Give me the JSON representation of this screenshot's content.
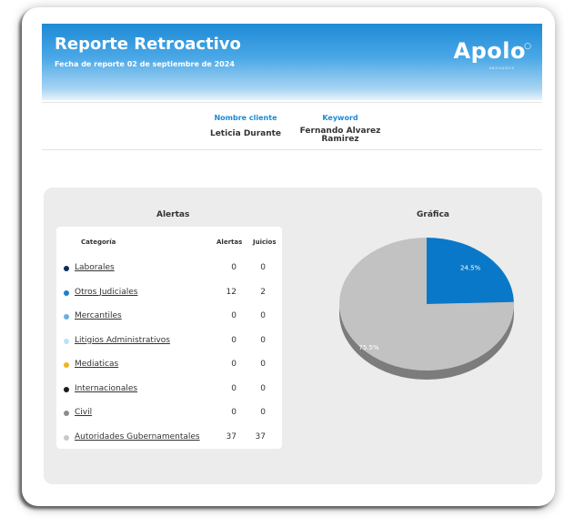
{
  "header": {
    "title": "Reporte Retroactivo",
    "date": "Fecha de reporte 02 de septiembre de 2024",
    "logo": "Apolo",
    "logo_sub": "ABOGADOS"
  },
  "client": {
    "name_label": "Nombre cliente",
    "name_value": "Leticia Durante",
    "keyword_label": "Keyword",
    "keyword_value_line1": "Fernando Alvarez",
    "keyword_value_line2": "Ramirez"
  },
  "alerts": {
    "title": "Alertas",
    "col_category": "Categoría",
    "col_alerts": "Alertas",
    "col_judgements": "Juicios",
    "rows": [
      {
        "name": "Laborales",
        "alerts": "0",
        "judgements": "0",
        "color": "#0d2c54"
      },
      {
        "name": "Otros Judiciales",
        "alerts": "12",
        "judgements": "2",
        "color": "#1a7fd0"
      },
      {
        "name": "Mercantiles",
        "alerts": "0",
        "judgements": "0",
        "color": "#6aaee0"
      },
      {
        "name": "Litigios Administrativos",
        "alerts": "0",
        "judgements": "0",
        "color": "#bfe1f5"
      },
      {
        "name": "Mediaticas",
        "alerts": "0",
        "judgements": "0",
        "color": "#f2b31c"
      },
      {
        "name": "Internacionales",
        "alerts": "0",
        "judgements": "0",
        "color": "#1a1a1a"
      },
      {
        "name": "Civil",
        "alerts": "0",
        "judgements": "0",
        "color": "#8c8c8c"
      },
      {
        "name": "Autoridades Gubernamentales",
        "alerts": "37",
        "judgements": "37",
        "color": "#c8c8c8"
      }
    ]
  },
  "chart_data": {
    "type": "pie",
    "title": "Gráfica",
    "slices": [
      {
        "label": "24.5%",
        "value": 24.5,
        "color": "#0a78c8"
      },
      {
        "label": "75.5%",
        "value": 75.5,
        "color": "#c2c2c2"
      }
    ]
  }
}
